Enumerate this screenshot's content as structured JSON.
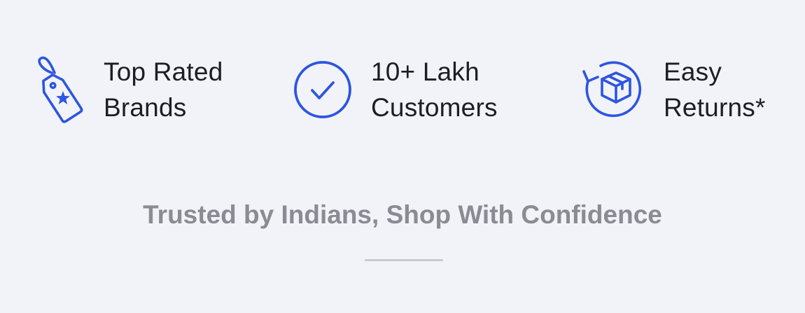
{
  "colors": {
    "background": "#f2f3f8",
    "icon_accent": "#2d55e0",
    "text_primary": "#1d1d22",
    "text_muted": "#8a8b93",
    "divider": "#c9cad0"
  },
  "features": [
    {
      "icon": "star-tag-icon",
      "line1": "Top Rated",
      "line2": "Brands"
    },
    {
      "icon": "check-circle-icon",
      "line1": "10+ Lakh",
      "line2": "Customers"
    },
    {
      "icon": "box-return-icon",
      "line1": "Easy",
      "line2": "Returns*"
    }
  ],
  "tagline": "Trusted by Indians, Shop With Confidence"
}
